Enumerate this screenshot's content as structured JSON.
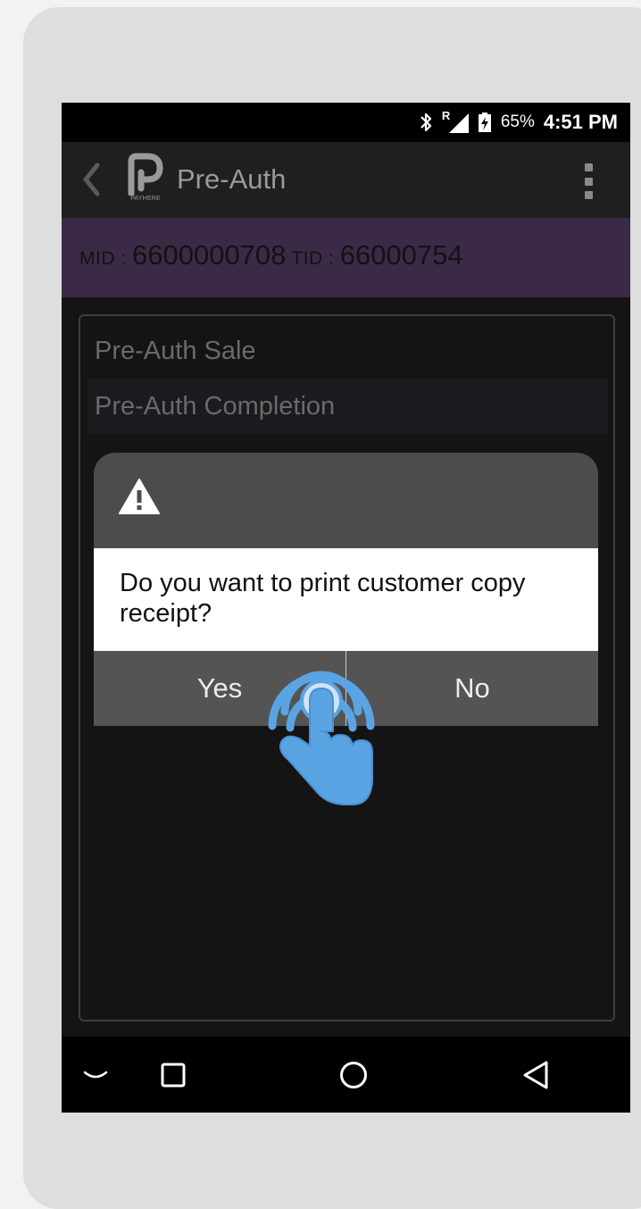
{
  "status_bar": {
    "roaming_label": "R",
    "battery_text": "65%",
    "time": "4:51 PM"
  },
  "app_bar": {
    "logo_text": "PAYHERE",
    "title": "Pre-Auth"
  },
  "merchant": {
    "mid_label": "MID : ",
    "mid_value": "6600000708",
    "tid_label": " TID : ",
    "tid_value": "66000754"
  },
  "menu": {
    "items": [
      {
        "label": "Pre-Auth Sale"
      },
      {
        "label": "Pre-Auth Completion"
      }
    ]
  },
  "dialog": {
    "message": "Do you want to print customer copy receipt?",
    "yes_label": "Yes",
    "no_label": "No"
  },
  "colors": {
    "merchant_bar": "#3b2a45",
    "tap_overlay": "#5aa4e4",
    "dialog_buttons": "#545454"
  },
  "icons": [
    "back-chevron-icon",
    "payhere-logo-icon",
    "overflow-menu-icon",
    "bluetooth-icon",
    "signal-icon",
    "battery-charging-icon",
    "warning-icon",
    "nav-keyboard-hide-icon",
    "nav-recents-icon",
    "nav-home-icon",
    "nav-back-icon",
    "tap-gesture-icon"
  ]
}
